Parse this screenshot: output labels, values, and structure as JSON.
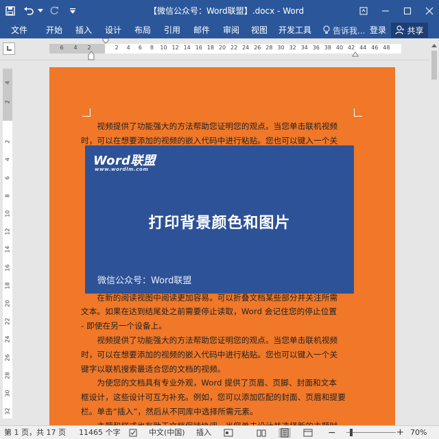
{
  "window": {
    "title": "【微信公众号：Word联盟】.docx - Word"
  },
  "ribbon": {
    "tabs": [
      "文件",
      "开始",
      "插入",
      "设计",
      "布局",
      "引用",
      "邮件",
      "审阅",
      "视图",
      "开发工具"
    ],
    "tell_me": "告诉我...",
    "login": "登录",
    "share": "共享"
  },
  "ruler": {
    "ticks": [
      "6",
      "4",
      "2",
      "2",
      "4",
      "6",
      "8",
      "10",
      "12",
      "14",
      "16",
      "18",
      "20",
      "22",
      "24",
      "26",
      "28",
      "30",
      "32",
      "34",
      "36",
      "38",
      "40",
      "42",
      "44",
      "46",
      "48"
    ],
    "vticks": [
      "4",
      "2",
      "2",
      "4",
      "6",
      "8",
      "10",
      "12",
      "14",
      "16",
      "18",
      "20",
      "22",
      "24",
      "26",
      "28",
      "30",
      "32"
    ]
  },
  "document": {
    "lines": [
      "　　视频提供了功能强大的方法帮助您证明您的观点。当您单击联机视频",
      "时，可以在想要添加的视频的嵌入代码中进行粘贴。您也可以键入一个关",
      "",
      "",
      "",
      "",
      "",
      "",
      "",
      "",
      "",
      "",
      "　　在新的阅读视图中阅读更加容易。可以折叠文档某些部分并关注所需",
      "文本。如果在达到结尾处之前需要停止读取，Word 会记住您的停止位置",
      "- 即使在另一个设备上。",
      "　　视频提供了功能强大的方法帮助您证明您的观点。当您单击联机视频",
      "时，可以在想要添加的视频的嵌入代码中进行粘贴。您也可以键入一个关",
      "键字以联机搜索最适合您的文档的视频。",
      "　　为使您的文档具有专业外观，Word 提供了页眉、页脚、封面和文本",
      "框设计，这些设计可互为补充。例如，您可以添加匹配的封面、页眉和提要",
      "栏。单击“插入”，然后从不同库中选择所需元素。",
      "　　主题和样式也有助于文档保持协调。当您单击设计并选择新的主题时，"
    ]
  },
  "banner": {
    "logo": "Word联盟",
    "logo_sub": "www.wordlm.com",
    "title": "打印背景颜色和图片",
    "footer": "微信公众号：Word联盟"
  },
  "status": {
    "page": "第 1 页，共 17 页",
    "words": "11465 个字",
    "language": "中文(中国)",
    "mode": "插入",
    "zoom": "70%"
  },
  "colors": {
    "ribbon": "#2b579a",
    "page_bg": "#f07828",
    "banner_bg": "#2d5297"
  }
}
